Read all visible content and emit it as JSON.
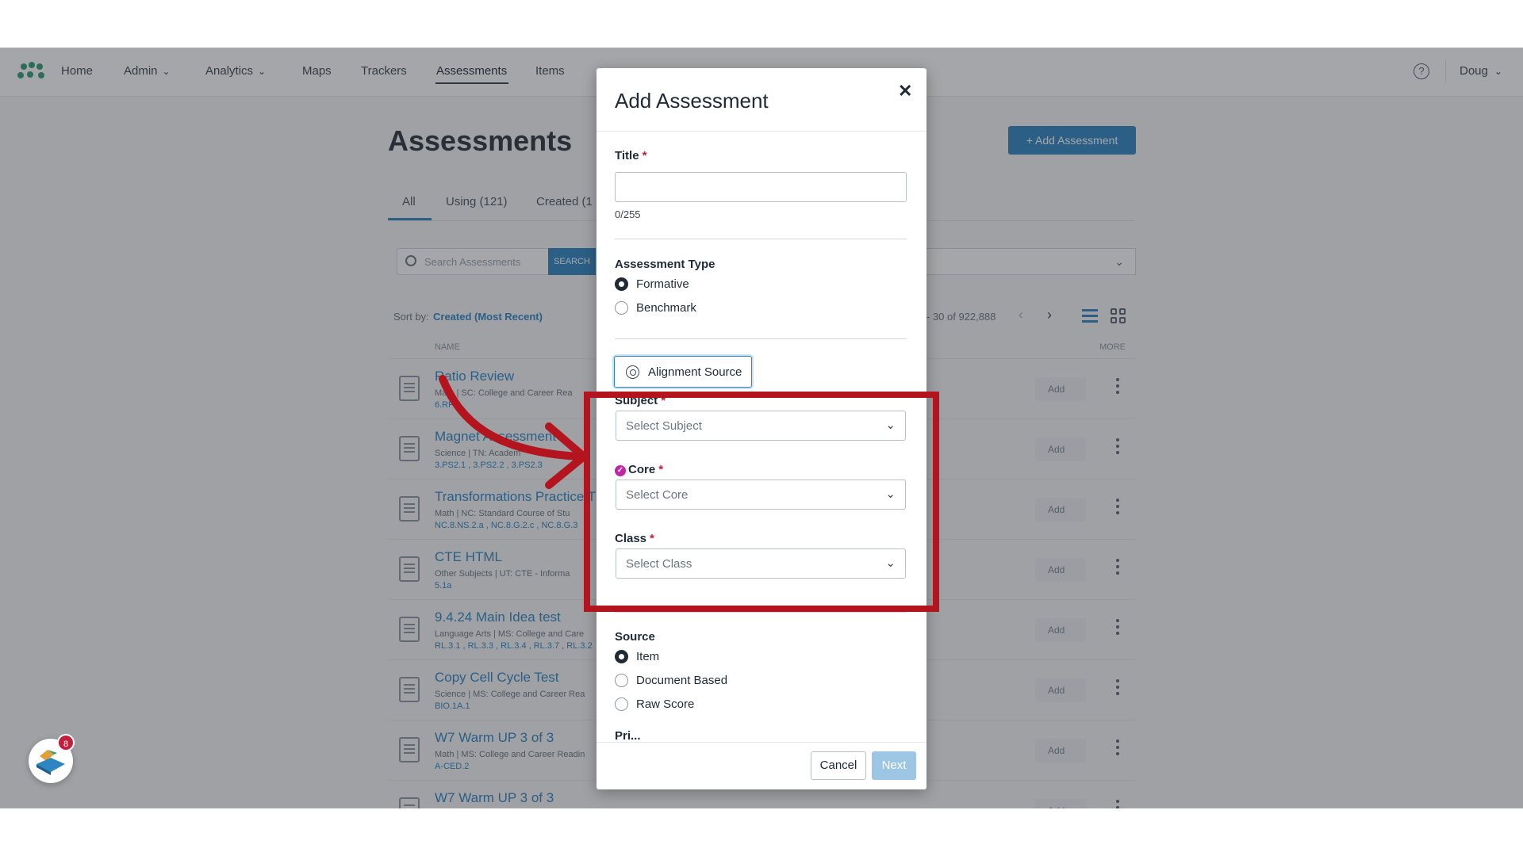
{
  "nav": {
    "items": [
      {
        "label": "Home"
      },
      {
        "label": "Admin"
      },
      {
        "label": "Analytics"
      },
      {
        "label": "Maps"
      },
      {
        "label": "Trackers"
      },
      {
        "label": "Assessments"
      },
      {
        "label": "Items"
      }
    ],
    "active": "Assessments",
    "user": "Doug",
    "help_icon": "question-circle-icon"
  },
  "page": {
    "title": "Assessments",
    "add_button": "+ Add Assessment",
    "tabs": [
      {
        "label": "All"
      },
      {
        "label": "Using (121)"
      },
      {
        "label": "Created (1"
      }
    ],
    "search_placeholder": "Search Assessments",
    "search_button": "SEARCH",
    "sort_label": "Sort by:",
    "sort_value": "Created (Most Recent)",
    "pager": "- 30 of 922,888",
    "col_name": "NAME",
    "col_more": "MORE",
    "rows": [
      {
        "title": "Ratio Review",
        "meta": "Math  |  SC: College and Career Rea",
        "std": "6.RP..."
      },
      {
        "title": "Magnet Assessment",
        "meta": "Science  |  TN: Academ",
        "std": "3.PS2.1 , 3.PS2.2 , 3.PS2.3"
      },
      {
        "title": "Transformations Practice T",
        "meta": "Math  |  NC: Standard Course of Stu",
        "std": "NC.8.NS.2.a , NC.8.G.2.c , NC.8.G.3"
      },
      {
        "title": "CTE HTML",
        "meta": "Other Subjects  |  UT: CTE - Informa",
        "std": "5.1a"
      },
      {
        "title": "9.4.24 Main Idea test",
        "meta": "Language Arts  |  MS: College and Care",
        "std": "RL.3.1 , RL.3.3 , RL.3.4 , RL.3.7 , RL.3.2"
      },
      {
        "title": "Copy Cell Cycle Test",
        "meta": "Science  |  MS: College and Career Rea",
        "std": "BIO.1A.1"
      },
      {
        "title": "W7 Warm UP 3 of 3",
        "meta": "Math  |  MS: College and Career Readin",
        "std": "A-CED.2"
      },
      {
        "title": "W7 Warm UP 3 of 3",
        "meta": "",
        "std": ""
      }
    ],
    "row_add_label": "Add"
  },
  "modal": {
    "title": "Add Assessment",
    "close_icon": "close-icon",
    "title_label": "Title",
    "title_value": "",
    "char_count": "0/255",
    "type_label": "Assessment Type",
    "type_options": [
      {
        "label": "Formative",
        "checked": true
      },
      {
        "label": "Benchmark",
        "checked": false
      }
    ],
    "alignment_button": "Alignment Source",
    "subject_label": "Subject",
    "subject_placeholder": "Select Subject",
    "core_label": "Core",
    "core_placeholder": "Select Core",
    "class_label": "Class",
    "class_placeholder": "Select Class",
    "source_label": "Source",
    "source_options": [
      {
        "label": "Item",
        "checked": true
      },
      {
        "label": "Document Based",
        "checked": false
      },
      {
        "label": "Raw Score",
        "checked": false
      }
    ],
    "cut_label": "Pri...",
    "cancel": "Cancel",
    "next": "Next",
    "required_mark": "*"
  },
  "chat": {
    "badge_count": "8"
  },
  "colors": {
    "accent": "#2e86c1",
    "highlight": "#b3141d",
    "verified": "#c026a6"
  }
}
